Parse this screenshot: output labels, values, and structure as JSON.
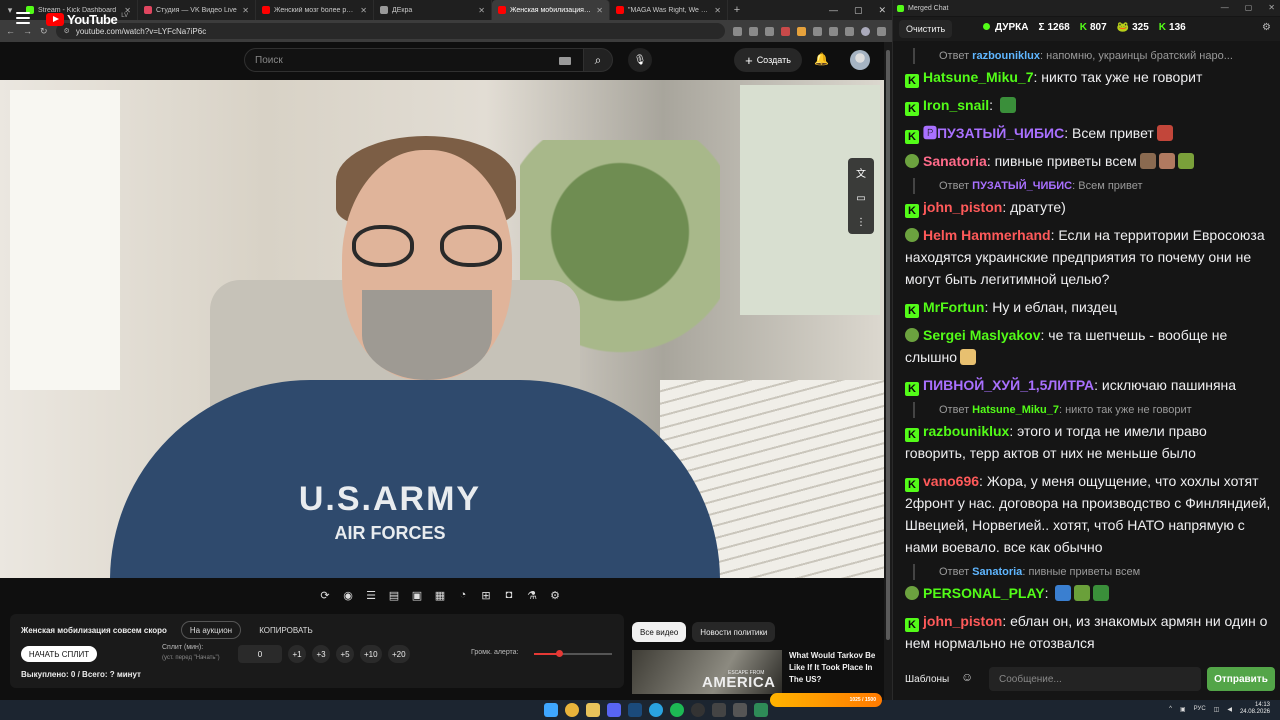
{
  "browser": {
    "tabs": [
      {
        "title": "Stream - Kick Dashboard",
        "fav": "#53fc18",
        "active": false
      },
      {
        "title": "Студия — VK Видео Live",
        "fav": "#e0465f",
        "active": false
      },
      {
        "title": "Женский мозг более развит",
        "fav": "#ff0000",
        "active": false
      },
      {
        "title": "ДЕкра",
        "fav": "#9a9a9a",
        "active": false
      },
      {
        "title": "Женская мобилизация совсем",
        "fav": "#ff0000",
        "active": true
      },
      {
        "title": "\"MAGA Was Right, We Were C",
        "fav": "#ff0000",
        "active": false
      }
    ],
    "url": "youtube.com/watch?v=LYFcNa7iP6c"
  },
  "youtube": {
    "logo_text": "YouTube",
    "region": "LV",
    "search_placeholder": "Поиск",
    "create_label": "Создать",
    "video_print_line1": "U.S.ARMY",
    "video_print_line2": "AIR FORCES",
    "chips": [
      "Все видео",
      "Новости политики"
    ],
    "recommendation": {
      "title": "What Would Tarkov Be Like If It Took Place In The US?",
      "thumb_text": "AMERICA",
      "thumb_small": "ESCAPE FROM"
    }
  },
  "auction": {
    "title": "Женская мобилизация совсем скоро",
    "to_auction": "На аукцион",
    "copy": "КОПИРОВАТЬ",
    "start_split": "НАЧАТЬ СПЛИТ",
    "split_label": "Сплит (мин):",
    "split_sub": "(уст. перед \"Начать\")",
    "split_value": "0",
    "increments": [
      "+1",
      "+3",
      "+5",
      "+10",
      "+20"
    ],
    "volume_label": "Громк. алерта:",
    "volume": 0.32,
    "status": "Выкуплено: 0 / Всего: ? минут"
  },
  "chat": {
    "window_title": "Merged Chat",
    "clear": "Очистить",
    "channel": "ДУРКА",
    "stats": [
      {
        "icon": "Σ",
        "value": "1268"
      },
      {
        "icon": "K",
        "value": "807"
      },
      {
        "icon": "🐸",
        "value": "325"
      },
      {
        "icon": "K",
        "value": "136"
      }
    ],
    "messages": [
      {
        "type": "reply",
        "label": "Ответ",
        "to": "razbouniklux",
        "to_color": "#5fb6ff",
        "text": "напомню, украинцы братский наро..."
      },
      {
        "type": "msg",
        "badge": "kick",
        "nick": "Hatsune_Miku_7",
        "color": "#53fc18",
        "text": "никто так уже не говорит",
        "emotes": []
      },
      {
        "type": "msg",
        "badge": "kick",
        "nick": "Iron_snail",
        "color": "#53fc18",
        "text": "",
        "emotes": [
          "#3a8f3a"
        ]
      },
      {
        "type": "msg",
        "badge": "kick",
        "nick": "🅿ПУЗАТЫЙ_ЧИБИС",
        "color": "#a970ff",
        "text": "Всем привет",
        "emotes": [
          "#c2463a"
        ]
      },
      {
        "type": "msg",
        "badge": "pepe",
        "nick": "Sanatoria",
        "color": "#ff6b8a",
        "text": "пивные приветы всем",
        "emotes": [
          "#8a6a50",
          "#b07a60",
          "#7aa03a"
        ]
      },
      {
        "type": "reply",
        "label": "Ответ",
        "to": "ПУЗАТЫЙ_ЧИБИС",
        "to_color": "#a970ff",
        "text": "Всем привет"
      },
      {
        "type": "msg",
        "badge": "kick",
        "nick": "john_piston",
        "color": "#ff5a5a",
        "text": "дратуте)",
        "emotes": []
      },
      {
        "type": "msg",
        "badge": "pepe",
        "nick": "Helm Hammerhand",
        "color": "#ff5a5a",
        "text": "Если на территории Евросоюза находятся украинские предприятия то почему они не могут быть легитимной целью?",
        "emotes": []
      },
      {
        "type": "msg",
        "badge": "kick",
        "nick": "MrFortun",
        "color": "#53fc18",
        "text": "Ну и еблан, пиздец",
        "emotes": []
      },
      {
        "type": "msg",
        "badge": "pepe",
        "nick": "Sergei Maslyakov",
        "color": "#53fc18",
        "text": "че та шепчешь - вообще не слышно",
        "emotes": [
          "#e8c070"
        ]
      },
      {
        "type": "msg",
        "badge": "kick",
        "nick": "ПИВНОЙ_ХУЙ_1,5ЛИТРА",
        "color": "#a970ff",
        "text": "исключаю пашиняна",
        "emotes": []
      },
      {
        "type": "reply",
        "label": "Ответ",
        "to": "Hatsune_Miku_7",
        "to_color": "#53fc18",
        "text": "никто так уже не говорит"
      },
      {
        "type": "msg",
        "badge": "kick",
        "nick": "razbouniklux",
        "color": "#53fc18",
        "text": "этого и тогда не имели право говорить, терр актов от них не меньше было",
        "emotes": []
      },
      {
        "type": "msg",
        "badge": "kick",
        "nick": "vano696",
        "color": "#ff5a5a",
        "text": "Жора, у меня ощущение, что хохлы хотят 2фронт у нас. договора на производство с Финляндией, Швецией, Норвегией.. хотят, чтоб НАТО напрямую с нами воевало. все как обычно",
        "emotes": []
      },
      {
        "type": "reply",
        "label": "Ответ",
        "to": "Sanatoria",
        "to_color": "#5fb6ff",
        "text": "пивные приветы всем"
      },
      {
        "type": "msg",
        "badge": "pepe",
        "nick": "PERSONAL_PLAY",
        "color": "#53fc18",
        "text": "",
        "emotes": [
          "#3a7fd0",
          "#6aa03a",
          "#3a8f3a"
        ]
      },
      {
        "type": "msg",
        "badge": "kick",
        "nick": "john_piston",
        "color": "#ff5a5a",
        "text": "еблан он, из знакомых армян ни один о нем нормально не отозвался",
        "emotes": []
      }
    ],
    "templates": "Шаблоны",
    "input_placeholder": "Сообщение...",
    "send": "Отправить"
  },
  "taskbar": {
    "meme_text": "1025 / 1500",
    "lang": "РУС",
    "time": "14:13",
    "date": "24.08.2026"
  }
}
